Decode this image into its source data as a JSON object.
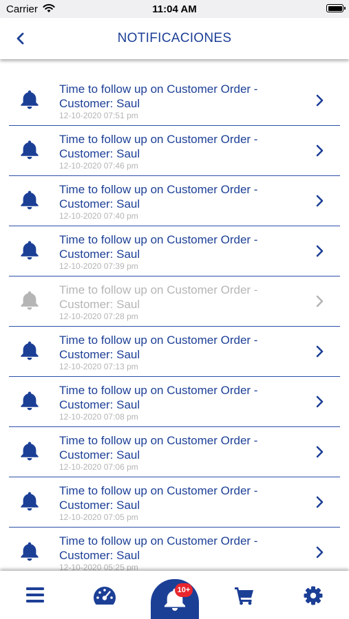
{
  "status_bar": {
    "carrier": "Carrier",
    "time": "11:04 AM"
  },
  "header": {
    "title": "NOTIFICACIONES"
  },
  "notifications": [
    {
      "title": "Time to follow up on Customer Order - Customer: Saul",
      "time": "12-10-2020 07:51 pm",
      "read": false
    },
    {
      "title": "Time to follow up on Customer Order - Customer: Saul",
      "time": "12-10-2020 07:46 pm",
      "read": false
    },
    {
      "title": "Time to follow up on Customer Order - Customer: Saul",
      "time": "12-10-2020 07:40 pm",
      "read": false
    },
    {
      "title": "Time to follow up on Customer Order - Customer: Saul",
      "time": "12-10-2020 07:39 pm",
      "read": false
    },
    {
      "title": "Time to follow up on Customer Order - Customer: Saul",
      "time": "12-10-2020 07:28 pm",
      "read": true
    },
    {
      "title": "Time to follow up on Customer Order - Customer: Saul",
      "time": "12-10-2020 07:13 pm",
      "read": false
    },
    {
      "title": "Time to follow up on Customer Order - Customer: Saul",
      "time": "12-10-2020 07:08 pm",
      "read": false
    },
    {
      "title": "Time to follow up on Customer Order - Customer: Saul",
      "time": "12-10-2020 07:06 pm",
      "read": false
    },
    {
      "title": "Time to follow up on Customer Order - Customer: Saul",
      "time": "12-10-2020 07:05 pm",
      "read": false
    },
    {
      "title": "Time to follow up on Customer Order - Customer: Saul",
      "time": "12-10-2020 05:25 pm",
      "read": false
    }
  ],
  "tab_bar": {
    "tabs": [
      "menu-icon",
      "dashboard-icon",
      "bell-icon",
      "cart-icon",
      "gear-icon"
    ],
    "badge": "10+"
  },
  "colors": {
    "accent": "#1c3f96",
    "read": "#b5b5b5",
    "badge": "#e8262e"
  }
}
